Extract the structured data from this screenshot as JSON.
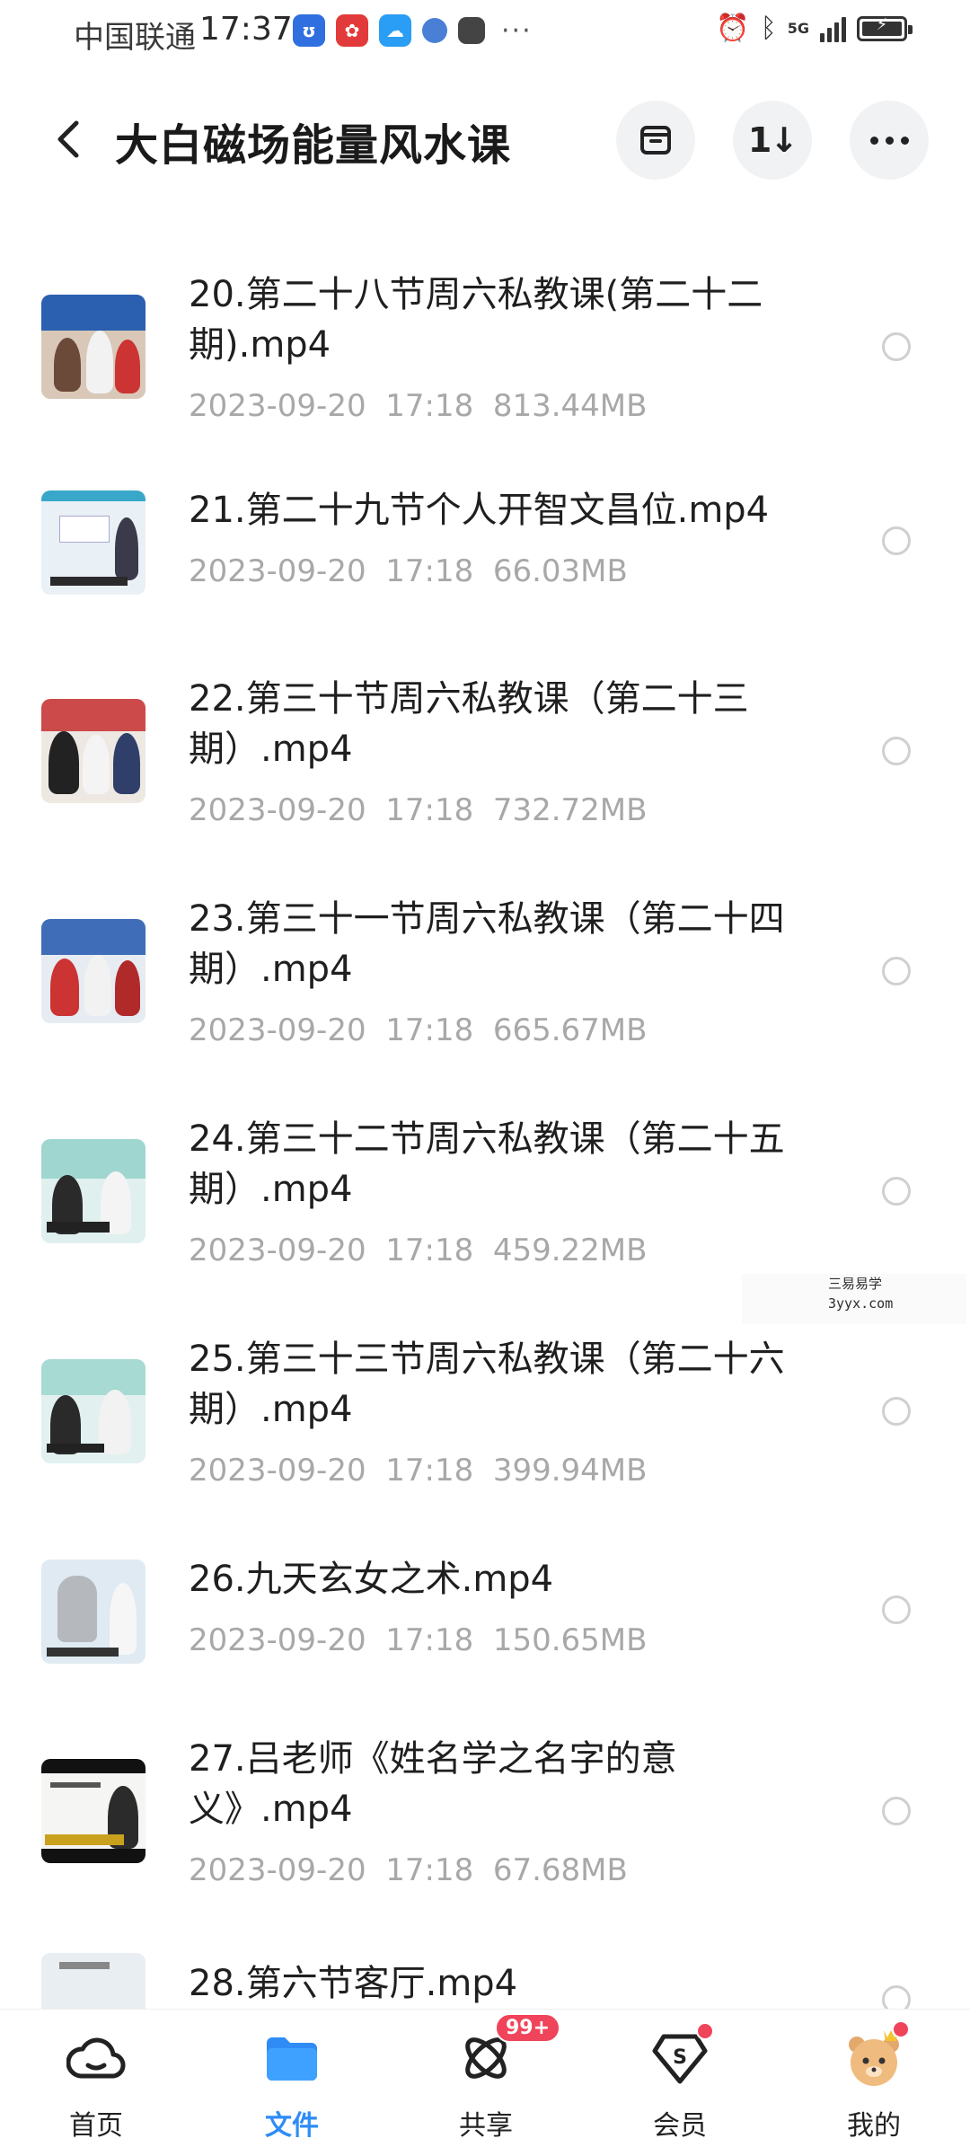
{
  "status_bar": {
    "carrier": "中国联通",
    "time": "17:37",
    "network": "5G",
    "more": "···"
  },
  "header": {
    "title": "大白磁场能量风水课",
    "sort_label": "1↓",
    "icons": [
      "back-arrow-icon",
      "archive-box-icon",
      "sort-icon",
      "more-icon"
    ]
  },
  "files": [
    {
      "name": "20.第二十八节周六私教课(第二十二期).mp4",
      "date": "2023-09-20",
      "time": "17:18",
      "size": "813.44MB"
    },
    {
      "name": "21.第二十九节个人开智文昌位.mp4",
      "date": "2023-09-20",
      "time": "17:18",
      "size": "66.03MB"
    },
    {
      "name": "22.第三十节周六私教课（第二十三期）.mp4",
      "date": "2023-09-20",
      "time": "17:18",
      "size": "732.72MB"
    },
    {
      "name": "23.第三十一节周六私教课（第二十四期）.mp4",
      "date": "2023-09-20",
      "time": "17:18",
      "size": "665.67MB"
    },
    {
      "name": "24.第三十二节周六私教课（第二十五期）.mp4",
      "date": "2023-09-20",
      "time": "17:18",
      "size": "459.22MB"
    },
    {
      "name": "25.第三十三节周六私教课（第二十六期）.mp4",
      "date": "2023-09-20",
      "time": "17:18",
      "size": "399.94MB"
    },
    {
      "name": "26.九天玄女之术.mp4",
      "date": "2023-09-20",
      "time": "17:18",
      "size": "150.65MB"
    },
    {
      "name": "27.吕老师《姓名学之名字的意义》.mp4",
      "date": "2023-09-20",
      "time": "17:18",
      "size": "67.68MB"
    },
    {
      "name": "28.第六节客厅.mp4",
      "date": "",
      "time": "",
      "size": ""
    }
  ],
  "watermark": {
    "line1": "三易易学",
    "line2": "3yyx.com"
  },
  "nav": {
    "items": [
      {
        "label": "首页",
        "icon": "cloud-home-icon",
        "active": false
      },
      {
        "label": "文件",
        "icon": "folder-icon",
        "active": true
      },
      {
        "label": "共享",
        "icon": "share-orbit-icon",
        "active": false
      },
      {
        "label": "会员",
        "icon": "vip-diamond-icon",
        "active": false
      },
      {
        "label": "我的",
        "icon": "avatar-bear-icon",
        "active": false
      }
    ],
    "share_badge": "99+"
  },
  "colors": {
    "accent": "#2f8cf6",
    "badge": "#f0445a",
    "meta_text": "#a8a8a8"
  }
}
